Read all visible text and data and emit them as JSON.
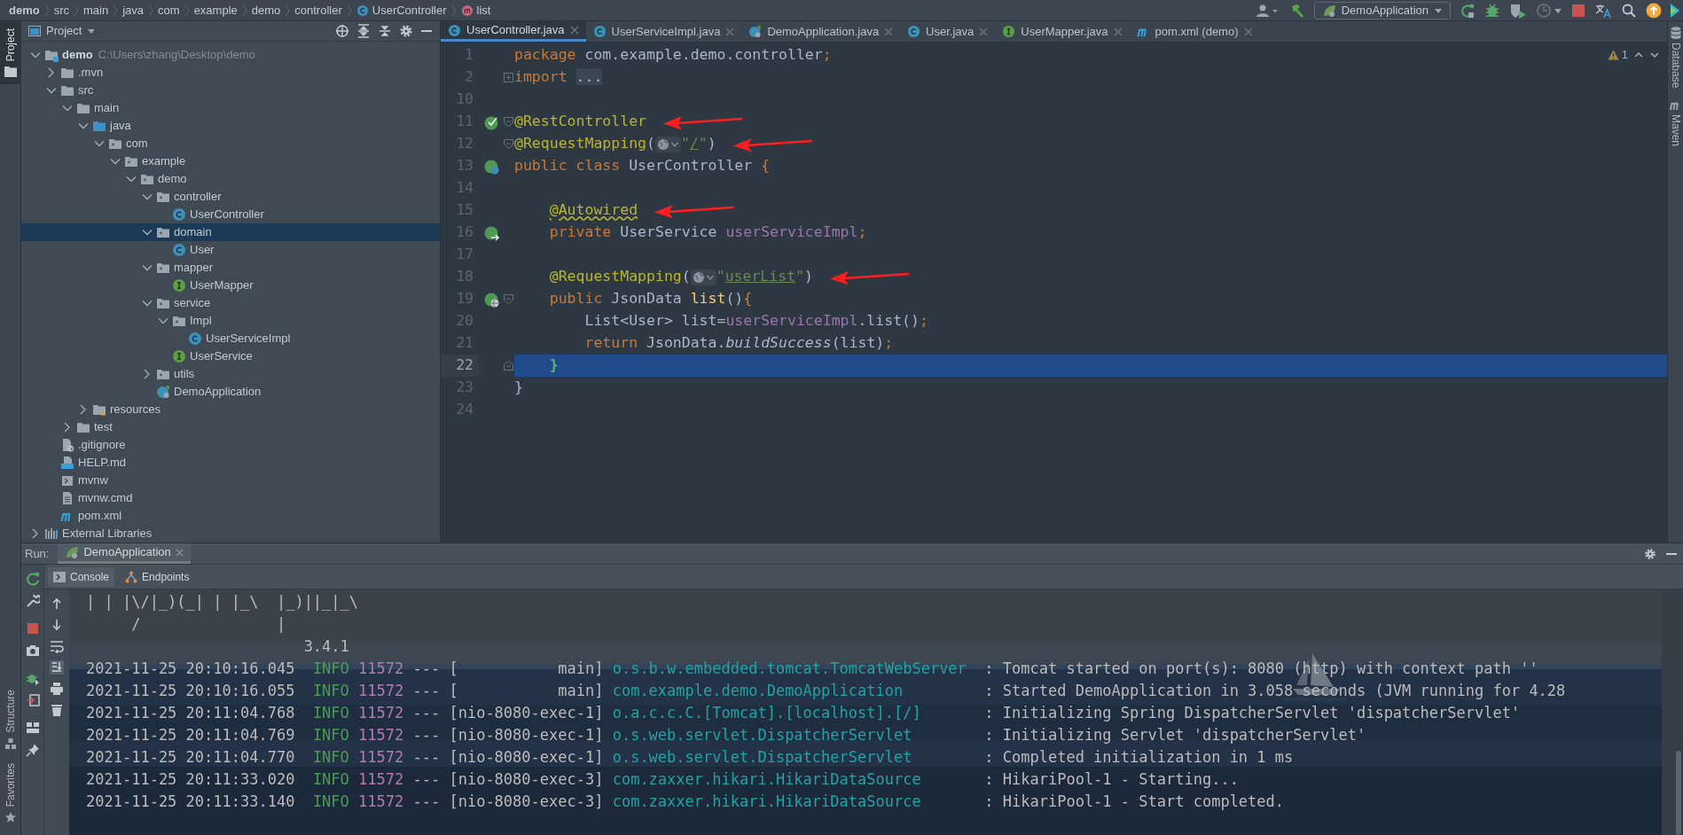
{
  "breadcrumb": [
    {
      "label": "demo",
      "kind": "module"
    },
    {
      "label": "src",
      "kind": "folder"
    },
    {
      "label": "main",
      "kind": "folder"
    },
    {
      "label": "java",
      "kind": "folder"
    },
    {
      "label": "com",
      "kind": "folder"
    },
    {
      "label": "example",
      "kind": "folder"
    },
    {
      "label": "demo",
      "kind": "folder"
    },
    {
      "label": "controller",
      "kind": "folder"
    },
    {
      "label": "UserController",
      "kind": "class"
    },
    {
      "label": "list",
      "kind": "method"
    }
  ],
  "toolbar": {
    "run_config": "DemoApplication"
  },
  "tool_windows_top": [
    {
      "label": "Project",
      "selected": true
    }
  ],
  "tool_windows_bottom": [
    {
      "label": "Structure",
      "selected": false
    },
    {
      "label": "Favorites",
      "selected": false
    }
  ],
  "tool_windows_right": [
    {
      "label": "Database",
      "kind": "database"
    },
    {
      "label": "Maven",
      "kind": "maven"
    }
  ],
  "project": {
    "title": "Project",
    "tree": [
      {
        "label": "demo",
        "kind": "module",
        "path": "C:\\Users\\zhang\\Desktop\\demo",
        "expanded": true,
        "selected": false,
        "children": [
          {
            "label": ".mvn",
            "kind": "folder",
            "expanded": false,
            "selected": false
          },
          {
            "label": "src",
            "kind": "folder",
            "expanded": true,
            "selected": false,
            "children": [
              {
                "label": "main",
                "kind": "folder",
                "expanded": true,
                "selected": false,
                "children": [
                  {
                    "label": "java",
                    "kind": "source-folder",
                    "expanded": true,
                    "selected": false,
                    "children": [
                      {
                        "label": "com",
                        "kind": "package",
                        "expanded": true,
                        "selected": false,
                        "children": [
                          {
                            "label": "example",
                            "kind": "package",
                            "expanded": true,
                            "selected": false,
                            "children": [
                              {
                                "label": "demo",
                                "kind": "package",
                                "expanded": true,
                                "selected": false,
                                "children": [
                                  {
                                    "label": "controller",
                                    "kind": "package",
                                    "expanded": true,
                                    "selected": false,
                                    "children": [
                                      {
                                        "label": "UserController",
                                        "kind": "class",
                                        "selected": false
                                      }
                                    ]
                                  },
                                  {
                                    "label": "domain",
                                    "kind": "package",
                                    "expanded": true,
                                    "selected": true,
                                    "children": [
                                      {
                                        "label": "User",
                                        "kind": "class",
                                        "selected": false
                                      }
                                    ]
                                  },
                                  {
                                    "label": "mapper",
                                    "kind": "package",
                                    "expanded": true,
                                    "selected": false,
                                    "children": [
                                      {
                                        "label": "UserMapper",
                                        "kind": "interface",
                                        "selected": false
                                      }
                                    ]
                                  },
                                  {
                                    "label": "service",
                                    "kind": "package",
                                    "expanded": true,
                                    "selected": false,
                                    "children": [
                                      {
                                        "label": "Impl",
                                        "kind": "package",
                                        "expanded": true,
                                        "selected": false,
                                        "children": [
                                          {
                                            "label": "UserServiceImpl",
                                            "kind": "class",
                                            "selected": false
                                          }
                                        ]
                                      },
                                      {
                                        "label": "UserService",
                                        "kind": "interface",
                                        "selected": false
                                      }
                                    ]
                                  },
                                  {
                                    "label": "utils",
                                    "kind": "package",
                                    "expanded": false,
                                    "selected": false
                                  },
                                  {
                                    "label": "DemoApplication",
                                    "kind": "spring-class",
                                    "selected": false
                                  }
                                ]
                              }
                            ]
                          }
                        ]
                      }
                    ]
                  },
                  {
                    "label": "resources",
                    "kind": "resources-folder",
                    "expanded": false,
                    "selected": false
                  }
                ]
              },
              {
                "label": "test",
                "kind": "folder",
                "expanded": false,
                "selected": false
              }
            ]
          },
          {
            "label": ".gitignore",
            "kind": "ignore-file",
            "selected": false
          },
          {
            "label": "HELP.md",
            "kind": "markdown",
            "selected": false
          },
          {
            "label": "mvnw",
            "kind": "script",
            "selected": false
          },
          {
            "label": "mvnw.cmd",
            "kind": "text-file",
            "selected": false
          },
          {
            "label": "pom.xml",
            "kind": "maven",
            "selected": false
          }
        ]
      },
      {
        "label": "External Libraries",
        "kind": "libraries",
        "expanded": false,
        "selected": false
      }
    ]
  },
  "editor": {
    "tabs": [
      {
        "label": "UserController.java",
        "kind": "class",
        "selected": true
      },
      {
        "label": "UserServiceImpl.java",
        "kind": "class",
        "selected": false
      },
      {
        "label": "DemoApplication.java",
        "kind": "spring-class",
        "selected": false
      },
      {
        "label": "User.java",
        "kind": "class",
        "selected": false
      },
      {
        "label": "UserMapper.java",
        "kind": "interface",
        "selected": false
      },
      {
        "label": "pom.xml (demo)",
        "kind": "maven",
        "selected": false
      }
    ],
    "warning_count": "1",
    "lines": [
      {
        "number": "1",
        "current": false,
        "marked": false,
        "tokens": [
          {
            "text": "package ",
            "kind": "kw"
          },
          {
            "text": "com.example.demo.controller",
            "kind": "plain"
          },
          {
            "text": ";",
            "kind": "punct"
          }
        ]
      },
      {
        "number": "2",
        "current": false,
        "marked": false,
        "fold_marker": {
          "kind": "collapsed"
        },
        "tokens": [
          {
            "text": "import ",
            "kind": "kw"
          },
          {
            "text": "...",
            "kind": "folded"
          }
        ]
      },
      {
        "number": "10",
        "current": false,
        "marked": false
      },
      {
        "number": "11",
        "current": false,
        "marked": true,
        "fold_marker": {
          "kind": "start"
        },
        "gutter_icon": {
          "kind": "check"
        },
        "tokens": [
          {
            "text": "@RestController",
            "kind": "ann"
          }
        ]
      },
      {
        "number": "12",
        "current": false,
        "marked": true,
        "fold_marker": {
          "kind": "start"
        },
        "tokens": [
          {
            "text": "@RequestMapping",
            "kind": "ann"
          },
          {
            "text": "(",
            "kind": "plain"
          },
          {
            "kind": "inlay"
          },
          {
            "text": "\"",
            "kind": "str"
          },
          {
            "text": "/",
            "kind": "url"
          },
          {
            "text": "\"",
            "kind": "str"
          },
          {
            "text": ")",
            "kind": "plain"
          }
        ]
      },
      {
        "number": "13",
        "current": false,
        "marked": false,
        "gutter_icon": {
          "kind": "class"
        },
        "tokens": [
          {
            "text": "public class ",
            "kind": "kw"
          },
          {
            "text": "UserController ",
            "kind": "plain"
          },
          {
            "text": "{",
            "kind": "punct"
          }
        ]
      },
      {
        "number": "14",
        "current": false,
        "marked": false
      },
      {
        "number": "15",
        "current": false,
        "marked": true,
        "tokens": [
          {
            "text": "    @Autowired",
            "kind": "ann-warn"
          }
        ]
      },
      {
        "number": "16",
        "current": false,
        "marked": false,
        "gutter_icon": {
          "kind": "inject"
        },
        "tokens": [
          {
            "text": "    private ",
            "kind": "kw"
          },
          {
            "text": "UserService ",
            "kind": "plain"
          },
          {
            "text": "userServiceImpl",
            "kind": "field"
          },
          {
            "text": ";",
            "kind": "punct"
          }
        ]
      },
      {
        "number": "17",
        "current": false,
        "marked": false
      },
      {
        "number": "18",
        "current": false,
        "marked": true,
        "tokens": [
          {
            "text": "    @RequestMapping",
            "kind": "ann"
          },
          {
            "text": "(",
            "kind": "plain"
          },
          {
            "kind": "inlay"
          },
          {
            "text": "\"",
            "kind": "str"
          },
          {
            "text": "userList",
            "kind": "url"
          },
          {
            "text": "\"",
            "kind": "str"
          },
          {
            "text": ")",
            "kind": "plain"
          }
        ]
      },
      {
        "number": "19",
        "current": false,
        "marked": false,
        "fold_marker": {
          "kind": "start"
        },
        "gutter_icon": {
          "kind": "web"
        },
        "tokens": [
          {
            "text": "    public ",
            "kind": "kw"
          },
          {
            "text": "JsonData ",
            "kind": "plain"
          },
          {
            "text": "list",
            "kind": "fn"
          },
          {
            "text": "()",
            "kind": "plain"
          },
          {
            "text": "{",
            "kind": "punct"
          }
        ]
      },
      {
        "number": "20",
        "current": false,
        "marked": false,
        "tokens": [
          {
            "text": "        List<User> list=",
            "kind": "plain"
          },
          {
            "text": "userServiceImpl",
            "kind": "field"
          },
          {
            "text": ".list()",
            "kind": "plain"
          },
          {
            "text": ";",
            "kind": "punct"
          }
        ]
      },
      {
        "number": "21",
        "current": false,
        "marked": false,
        "tokens": [
          {
            "text": "        return ",
            "kind": "kw"
          },
          {
            "text": "JsonData.",
            "kind": "plain"
          },
          {
            "text": "buildSuccess",
            "kind": "static"
          },
          {
            "text": "(list)",
            "kind": "plain"
          },
          {
            "text": ";",
            "kind": "punct"
          }
        ]
      },
      {
        "number": "22",
        "current": true,
        "marked": false,
        "fold_marker": {
          "kind": "end"
        },
        "tokens": [
          {
            "text": "    }",
            "kind": "match"
          }
        ]
      },
      {
        "number": "23",
        "current": false,
        "marked": false,
        "tokens": [
          {
            "text": "}",
            "kind": "plain"
          }
        ]
      },
      {
        "number": "24",
        "current": false,
        "marked": false
      }
    ]
  },
  "run": {
    "label": "Run:",
    "tabs": [
      {
        "label": "DemoApplication",
        "selected": true
      }
    ],
    "subtabs": [
      {
        "label": "Console",
        "kind": "console",
        "selected": true
      },
      {
        "label": "Endpoints",
        "kind": "endpoints",
        "selected": false
      }
    ],
    "console": [
      {
        "kind": "text",
        "text": "| | |\\/|_)(_| | |_\\  |_)||_|_\\"
      },
      {
        "kind": "text",
        "text": "     /               |"
      },
      {
        "kind": "text",
        "text": "                        3.4.1"
      },
      {
        "kind": "log",
        "time": "2021-11-25 20:10:16.045",
        "level": "INFO",
        "pid": "11572",
        "sep": "---",
        "thread": "[           main]",
        "logger": "o.s.b.w.embedded.tomcat.TomcatWebServer",
        "message": ": Tomcat started on port(s): 8080 (http) with context path ''"
      },
      {
        "kind": "log",
        "time": "2021-11-25 20:10:16.055",
        "level": "INFO",
        "pid": "11572",
        "sep": "---",
        "thread": "[           main]",
        "logger": "com.example.demo.DemoApplication",
        "message": ": Started DemoApplication in 3.058 seconds (JVM running for 4.28"
      },
      {
        "kind": "log",
        "time": "2021-11-25 20:11:04.768",
        "level": "INFO",
        "pid": "11572",
        "sep": "---",
        "thread": "[nio-8080-exec-1]",
        "logger": "o.a.c.c.C.[Tomcat].[localhost].[/]",
        "message": ": Initializing Spring DispatcherServlet 'dispatcherServlet'"
      },
      {
        "kind": "log",
        "time": "2021-11-25 20:11:04.769",
        "level": "INFO",
        "pid": "11572",
        "sep": "---",
        "thread": "[nio-8080-exec-1]",
        "logger": "o.s.web.servlet.DispatcherServlet",
        "message": ": Initializing Servlet 'dispatcherServlet'"
      },
      {
        "kind": "log",
        "time": "2021-11-25 20:11:04.770",
        "level": "INFO",
        "pid": "11572",
        "sep": "---",
        "thread": "[nio-8080-exec-1]",
        "logger": "o.s.web.servlet.DispatcherServlet",
        "message": ": Completed initialization in 1 ms"
      },
      {
        "kind": "log",
        "time": "2021-11-25 20:11:33.020",
        "level": "INFO",
        "pid": "11572",
        "sep": "---",
        "thread": "[nio-8080-exec-3]",
        "logger": "com.zaxxer.hikari.HikariDataSource",
        "message": ": HikariPool-1 - Starting..."
      },
      {
        "kind": "log",
        "time": "2021-11-25 20:11:33.140",
        "level": "INFO",
        "pid": "11572",
        "sep": "---",
        "thread": "[nio-8080-exec-3]",
        "logger": "com.zaxxer.hikari.HikariDataSource",
        "message": ": HikariPool-1 - Start completed."
      }
    ]
  }
}
